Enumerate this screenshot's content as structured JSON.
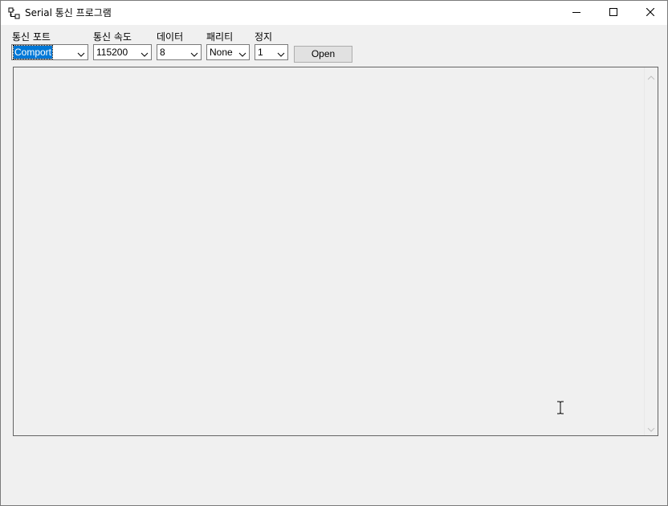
{
  "window": {
    "title": "Serial 통신 프로그램",
    "icon": "serial-port-icon",
    "controls": {
      "minimize_icon": "minimize-icon",
      "maximize_icon": "maximize-icon",
      "close_icon": "close-icon"
    }
  },
  "settings": {
    "port": {
      "label": "통신 포트",
      "value": "Comport"
    },
    "baud": {
      "label": "통신 속도",
      "value": "115200"
    },
    "data_bits": {
      "label": "데이터",
      "value": "8"
    },
    "parity": {
      "label": "패리티",
      "value": "None"
    },
    "stop_bits": {
      "label": "정지",
      "value": "1"
    },
    "open_button": "Open"
  },
  "log": {
    "text": ""
  },
  "colors": {
    "selection": "#0078d7",
    "window_bg": "#f0f0f0",
    "titlebar_bg": "#ffffff",
    "button_bg": "#e1e1e1"
  }
}
